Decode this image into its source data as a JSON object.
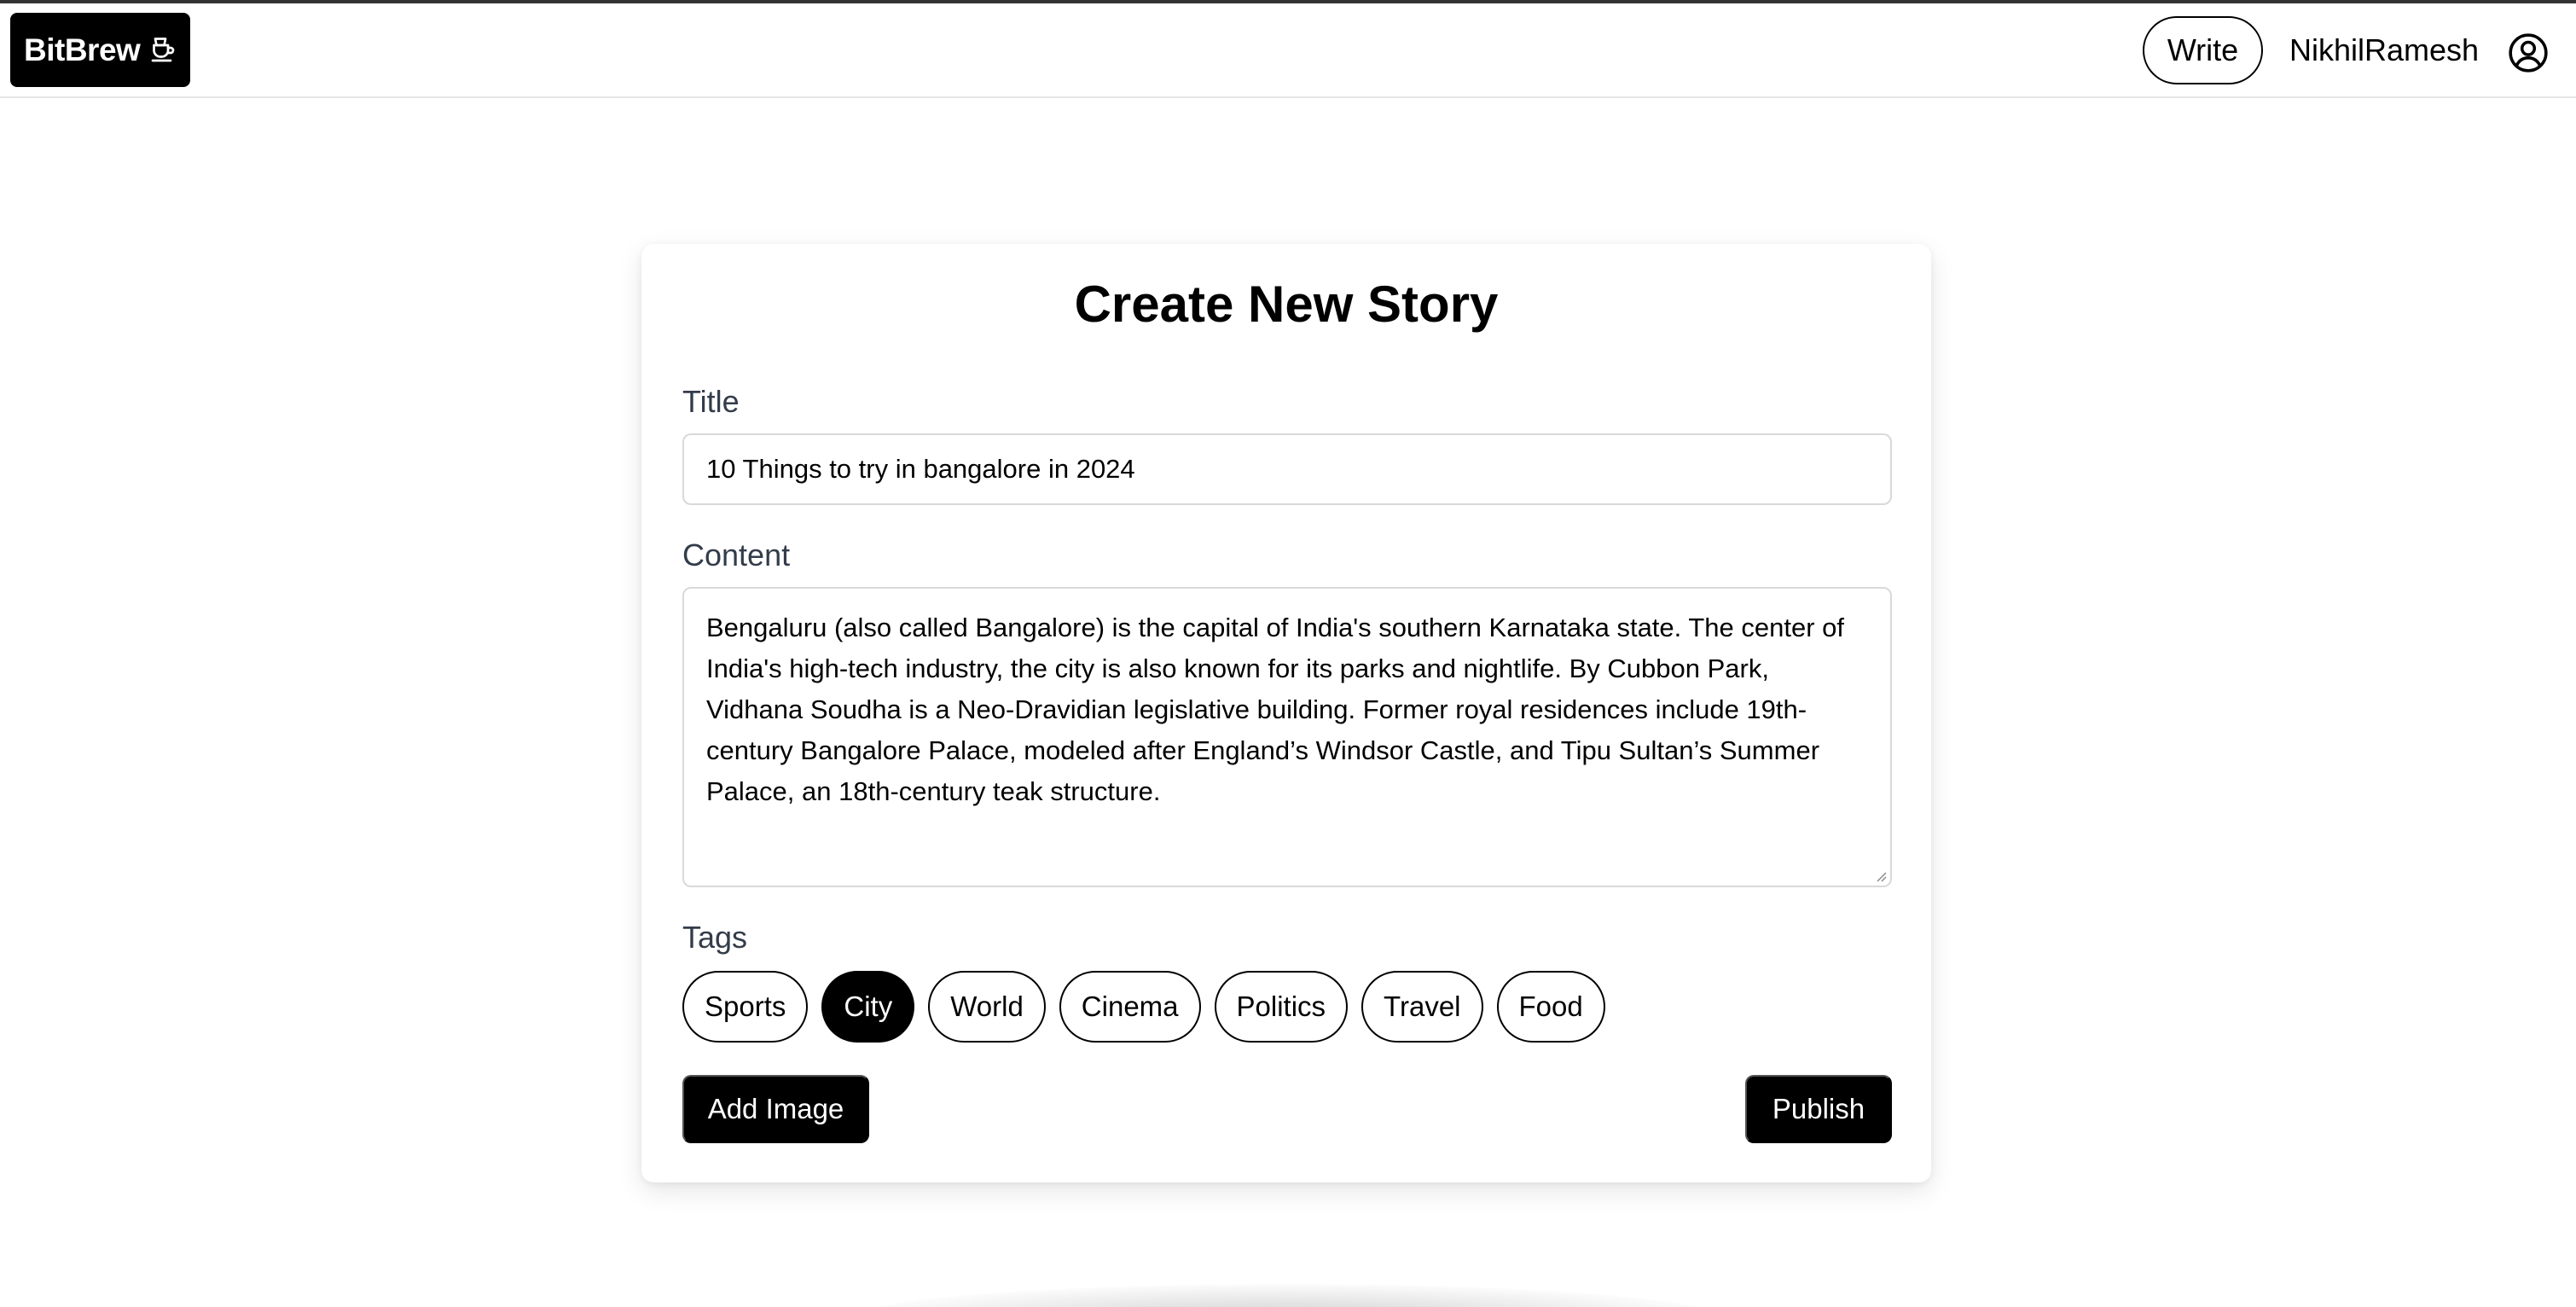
{
  "navbar": {
    "brand": "BitBrew",
    "brand_icon": "coffee-pot-icon",
    "write_label": "Write",
    "username": "NikhilRamesh",
    "user_icon": "user-circle-icon"
  },
  "form": {
    "heading": "Create New Story",
    "title_label": "Title",
    "title_value": "10 Things to try in bangalore in 2024",
    "content_label": "Content",
    "content_value": "Bengaluru (also called Bangalore) is the capital of India's southern Karnataka state. The center of India's high-tech industry, the city is also known for its parks and nightlife. By Cubbon Park, Vidhana Soudha is a Neo-Dravidian legislative building. Former royal residences include 19th-century Bangalore Palace, modeled after England’s Windsor Castle, and Tipu Sultan’s Summer Palace, an 18th-century teak structure.",
    "tags_label": "Tags",
    "tags": [
      {
        "label": "Sports",
        "selected": false
      },
      {
        "label": "City",
        "selected": true
      },
      {
        "label": "World",
        "selected": false
      },
      {
        "label": "Cinema",
        "selected": false
      },
      {
        "label": "Politics",
        "selected": false
      },
      {
        "label": "Travel",
        "selected": false
      },
      {
        "label": "Food",
        "selected": false
      }
    ],
    "add_image_label": "Add Image",
    "publish_label": "Publish"
  },
  "colors": {
    "primary": "#000000",
    "label_text": "#333c4a",
    "input_border": "#d9d9d9"
  }
}
